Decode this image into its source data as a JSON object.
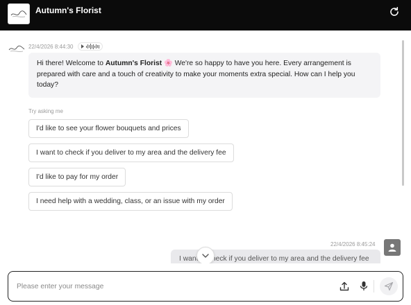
{
  "header": {
    "title": "Autumn's Florist",
    "logo_text": "Autumn's Florist",
    "refresh_icon": "refresh-icon"
  },
  "bot_message": {
    "timestamp": "22/4/2026 8:44:30",
    "intro": "Hi there! Welcome to ",
    "brand": "Autumn's Florist",
    "emoji": "🌸",
    "body": " We're so happy to have you here. Every arrangement is prepared with care and a touch of creativity to make your moments extra special. How can I help you today?"
  },
  "suggestions": {
    "label": "Try asking me",
    "items": [
      "I'd like to see your flower bouquets and prices",
      "I want to check if you deliver to my area and the delivery fee",
      "I'd like to pay for my order",
      "I need help with a wedding, class, or an issue with my order"
    ]
  },
  "user_message": {
    "timestamp": "22/4/2026 8:45:24",
    "text": "I want to check if you deliver to my area and the delivery fee"
  },
  "composer": {
    "placeholder": "Please enter your message",
    "value": ""
  },
  "colors": {
    "header_bg": "#0b0b0b",
    "bot_bubble_bg": "#f4f4f6",
    "user_bubble_bg": "#e9e9ec",
    "accent_flower": "#e8678e"
  }
}
